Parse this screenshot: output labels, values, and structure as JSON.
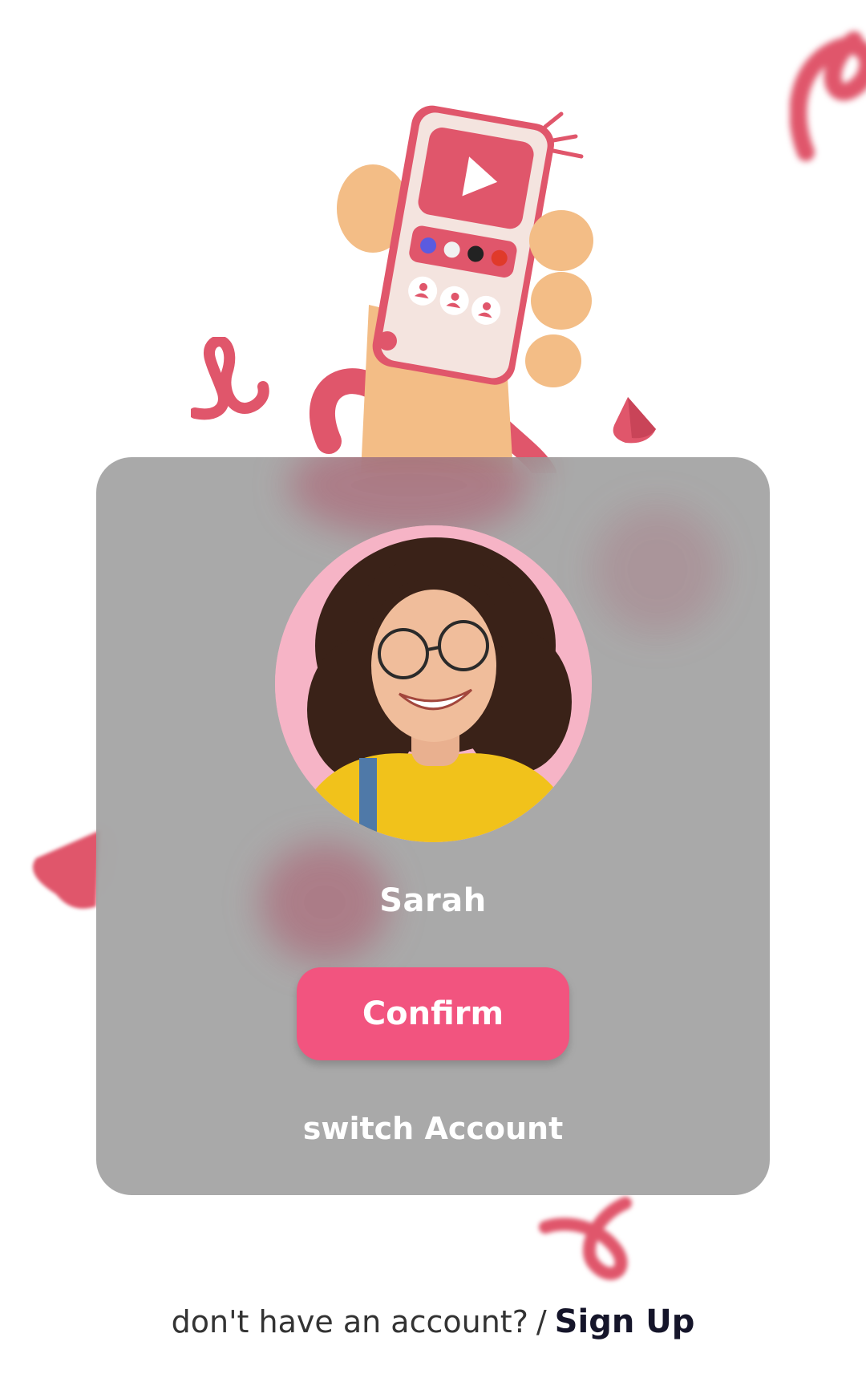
{
  "profile": {
    "name": "Sarah"
  },
  "actions": {
    "confirm_label": "Confirm",
    "switch_account_label": "switch Account"
  },
  "footer": {
    "question": "don't have an account?",
    "separator": "/",
    "signup_label": "Sign Up"
  },
  "colors": {
    "accent": "#f2547f",
    "card_overlay": "#a7a7a7",
    "decor_pink": "#e0566b",
    "avatar_bg": "#f6b4c6"
  },
  "icons": {
    "hero": "phone-in-hand-illustration",
    "play": "play-icon",
    "user": "user-icon"
  }
}
